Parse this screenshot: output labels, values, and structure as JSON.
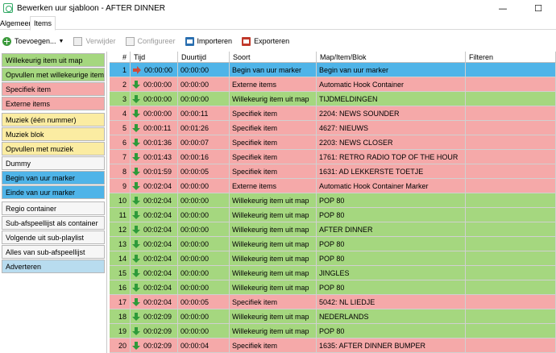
{
  "window": {
    "title": "Bewerken uur sjabloon - AFTER DINNER",
    "minimize_glyph": "—",
    "maximize_glyph": "☐"
  },
  "tabs": [
    "Algemeen",
    "Items"
  ],
  "toolbar": {
    "add_label": "Toevoegen...",
    "remove_label": "Verwijder",
    "configure_label": "Configureer",
    "import_label": "Importeren",
    "export_label": "Exporteren"
  },
  "colors": {
    "green": "#a5d77f",
    "red": "#f5a9a9",
    "yellow": "#fbeca2",
    "white": "#f6f6f6",
    "blue": "#4fb4e8",
    "lightblue": "#b8dcef"
  },
  "palette": [
    {
      "label": "Willekeurig item uit map",
      "color": "green"
    },
    {
      "label": "Opvullen met willekeurige items",
      "color": "green"
    },
    {
      "label": "Specifiek item",
      "color": "red"
    },
    {
      "label": "Externe items",
      "color": "red"
    },
    {
      "label": "Muziek (één nummer)",
      "color": "yellow"
    },
    {
      "label": "Muziek blok",
      "color": "yellow"
    },
    {
      "label": "Opvullen met muziek",
      "color": "yellow"
    },
    {
      "label": "Dummy",
      "color": "white"
    },
    {
      "label": "Begin van uur marker",
      "color": "blue"
    },
    {
      "label": "Einde van uur marker",
      "color": "blue"
    },
    {
      "label": "Regio container",
      "color": "white"
    },
    {
      "label": "Sub-afspeellijst als container",
      "color": "white"
    },
    {
      "label": "Volgende uit sub-playlist",
      "color": "white"
    },
    {
      "label": "Alles van sub-afspeellijst",
      "color": "white"
    },
    {
      "label": "Adverteren",
      "color": "lightblue"
    }
  ],
  "table": {
    "columns": [
      "#",
      "Tijd",
      "Duurtijd",
      "Soort",
      "Map/Item/Blok",
      "Filteren"
    ],
    "rows": [
      {
        "n": "1",
        "time": "00:00:00",
        "dur": "00:00:00",
        "type": "Begin van uur marker",
        "item": "Begin van uur marker",
        "filter": "",
        "color": "blue",
        "arrow": "right"
      },
      {
        "n": "2",
        "time": "00:00:00",
        "dur": "00:00:00",
        "type": "Externe items",
        "item": "Automatic Hook Container",
        "filter": "",
        "color": "red",
        "arrow": "down"
      },
      {
        "n": "3",
        "time": "00:00:00",
        "dur": "00:00:00",
        "type": "Willekeurig item uit map",
        "item": "TIJDMELDINGEN",
        "filter": "",
        "color": "green",
        "arrow": "down"
      },
      {
        "n": "4",
        "time": "00:00:00",
        "dur": "00:00:11",
        "type": "Specifiek item",
        "item": "2204: NEWS SOUNDER",
        "filter": "",
        "color": "red",
        "arrow": "down"
      },
      {
        "n": "5",
        "time": "00:00:11",
        "dur": "00:01:26",
        "type": "Specifiek item",
        "item": "4627: NIEUWS",
        "filter": "",
        "color": "red",
        "arrow": "down"
      },
      {
        "n": "6",
        "time": "00:01:36",
        "dur": "00:00:07",
        "type": "Specifiek item",
        "item": "2203: NEWS CLOSER",
        "filter": "",
        "color": "red",
        "arrow": "down"
      },
      {
        "n": "7",
        "time": "00:01:43",
        "dur": "00:00:16",
        "type": "Specifiek item",
        "item": "1761: RETRO RADIO TOP OF THE HOUR",
        "filter": "",
        "color": "red",
        "arrow": "down"
      },
      {
        "n": "8",
        "time": "00:01:59",
        "dur": "00:00:05",
        "type": "Specifiek item",
        "item": "1631: AD LEKKERSTE TOETJE",
        "filter": "",
        "color": "red",
        "arrow": "down"
      },
      {
        "n": "9",
        "time": "00:02:04",
        "dur": "00:00:00",
        "type": "Externe items",
        "item": "Automatic Hook Container Marker",
        "filter": "",
        "color": "red",
        "arrow": "down"
      },
      {
        "n": "10",
        "time": "00:02:04",
        "dur": "00:00:00",
        "type": "Willekeurig item uit map",
        "item": "POP 80",
        "filter": "",
        "color": "green",
        "arrow": "down"
      },
      {
        "n": "11",
        "time": "00:02:04",
        "dur": "00:00:00",
        "type": "Willekeurig item uit map",
        "item": "POP 80",
        "filter": "",
        "color": "green",
        "arrow": "down"
      },
      {
        "n": "12",
        "time": "00:02:04",
        "dur": "00:00:00",
        "type": "Willekeurig item uit map",
        "item": "AFTER DINNER",
        "filter": "",
        "color": "green",
        "arrow": "down"
      },
      {
        "n": "13",
        "time": "00:02:04",
        "dur": "00:00:00",
        "type": "Willekeurig item uit map",
        "item": "POP 80",
        "filter": "",
        "color": "green",
        "arrow": "down"
      },
      {
        "n": "14",
        "time": "00:02:04",
        "dur": "00:00:00",
        "type": "Willekeurig item uit map",
        "item": "POP 80",
        "filter": "",
        "color": "green",
        "arrow": "down"
      },
      {
        "n": "15",
        "time": "00:02:04",
        "dur": "00:00:00",
        "type": "Willekeurig item uit map",
        "item": "JINGLES",
        "filter": "",
        "color": "green",
        "arrow": "down"
      },
      {
        "n": "16",
        "time": "00:02:04",
        "dur": "00:00:00",
        "type": "Willekeurig item uit map",
        "item": "POP 80",
        "filter": "",
        "color": "green",
        "arrow": "down"
      },
      {
        "n": "17",
        "time": "00:02:04",
        "dur": "00:00:05",
        "type": "Specifiek item",
        "item": "5042: NL LIEDJE",
        "filter": "",
        "color": "red",
        "arrow": "down"
      },
      {
        "n": "18",
        "time": "00:02:09",
        "dur": "00:00:00",
        "type": "Willekeurig item uit map",
        "item": "NEDERLANDS",
        "filter": "",
        "color": "green",
        "arrow": "down"
      },
      {
        "n": "19",
        "time": "00:02:09",
        "dur": "00:00:00",
        "type": "Willekeurig item uit map",
        "item": "POP 80",
        "filter": "",
        "color": "green",
        "arrow": "down"
      },
      {
        "n": "20",
        "time": "00:02:09",
        "dur": "00:00:04",
        "type": "Specifiek item",
        "item": "1635: AFTER DINNER BUMPER",
        "filter": "",
        "color": "red",
        "arrow": "down"
      }
    ]
  }
}
